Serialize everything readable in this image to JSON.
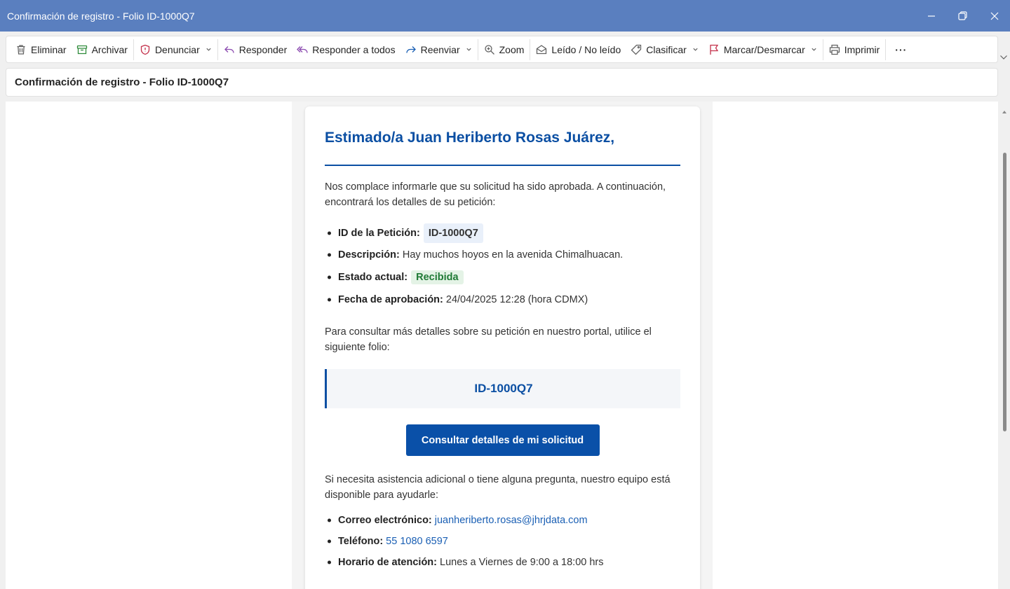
{
  "window": {
    "title": "Confirmación de registro - Folio ID-1000Q7"
  },
  "toolbar": {
    "items": [
      {
        "label": "Eliminar",
        "icon": "trash-icon"
      },
      {
        "label": "Archivar",
        "icon": "archive-icon"
      },
      {
        "label": "Denunciar",
        "icon": "shield-icon"
      },
      {
        "label": "Responder",
        "icon": "reply-icon"
      },
      {
        "label": "Responder a todos",
        "icon": "reply-all-icon"
      },
      {
        "label": "Reenviar",
        "icon": "forward-icon"
      },
      {
        "label": "Zoom",
        "icon": "zoom-icon"
      },
      {
        "label": "Leído / No leído",
        "icon": "envelope-icon"
      },
      {
        "label": "Clasificar",
        "icon": "tag-icon"
      },
      {
        "label": "Marcar/Desmarcar",
        "icon": "flag-icon"
      },
      {
        "label": "Imprimir",
        "icon": "printer-icon"
      },
      {
        "label": "···",
        "icon": "more-icon"
      }
    ]
  },
  "subject": "Confirmación de registro - Folio ID-1000Q7",
  "email": {
    "greeting": "Estimado/a Juan Heriberto Rosas Juárez,",
    "intro": "Nos complace informarle que su solicitud ha sido aprobada. A continuación, encontrará los detalles de su petición:",
    "details": {
      "id_label": "ID de la Petición:",
      "id_value": "ID-1000Q7",
      "desc_label": "Descripción:",
      "desc_value": "Hay muchos hoyos en la avenida Chimalhuacan.",
      "status_label": "Estado actual:",
      "status_value": "Recibida",
      "date_label": "Fecha de aprobación:",
      "date_value": "24/04/2025 12:28 (hora CDMX)"
    },
    "consult_text": "Para consultar más detalles sobre su petición en nuestro portal, utilice el siguiente folio:",
    "folio": "ID-1000Q7",
    "button_label": "Consultar detalles de mi solicitud",
    "assist_text": "Si necesita asistencia adicional o tiene alguna pregunta, nuestro equipo está disponible para ayudarle:",
    "contact": {
      "email_label": "Correo electrónico:",
      "email_value": "juanheriberto.rosas@jhrjdata.com",
      "phone_label": "Teléfono:",
      "phone_value": "55 1080 6597",
      "hours_label": "Horario de atención:",
      "hours_value": "Lunes a Viernes de 9:00 a 18:00 hrs"
    }
  },
  "colors": {
    "titlebar": "#5a7fbf",
    "accent": "#0b4fa3",
    "button": "#0a50a8",
    "status_bg": "#e4f3e6",
    "status_text": "#1f7a35"
  }
}
